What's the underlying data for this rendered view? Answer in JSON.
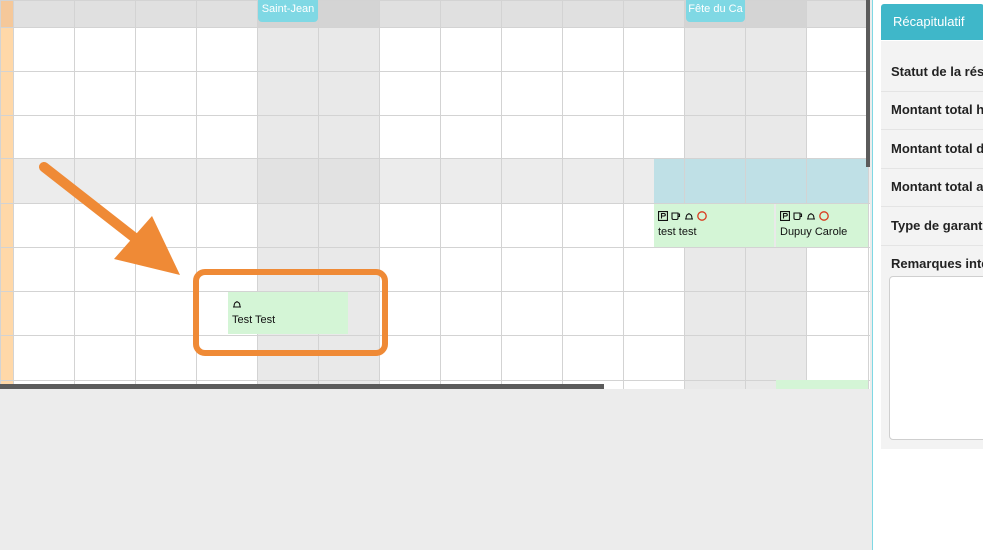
{
  "planner": {
    "holidays": [
      {
        "label": "Saint-Jean"
      },
      {
        "label": "Fête du Ca"
      }
    ],
    "bookings": [
      {
        "name": "Test Test",
        "icons": [
          "bell-icon"
        ]
      },
      {
        "name": "test test",
        "icons": [
          "parking-icon",
          "breakfast-cup-icon",
          "bell-icon",
          "circle-icon"
        ]
      },
      {
        "name": "Dupuy Carole",
        "icons": [
          "parking-icon",
          "breakfast-cup-icon",
          "bell-icon",
          "circle-icon"
        ]
      }
    ]
  },
  "sidepanel": {
    "tab_label": "Récapitulatif",
    "rows": [
      "Statut de la rés",
      "Montant total h",
      "Montant total d",
      "Montant total a",
      "Type de garant"
    ],
    "remarks_label": "Remarques inte",
    "remarks_value": ""
  },
  "colors": {
    "accent": "#3fb7c9",
    "holiday": "#7fd8e4",
    "booking": "#d4f5d6",
    "annotation": "#ef8a36",
    "today_column": "#ffd8a8"
  }
}
